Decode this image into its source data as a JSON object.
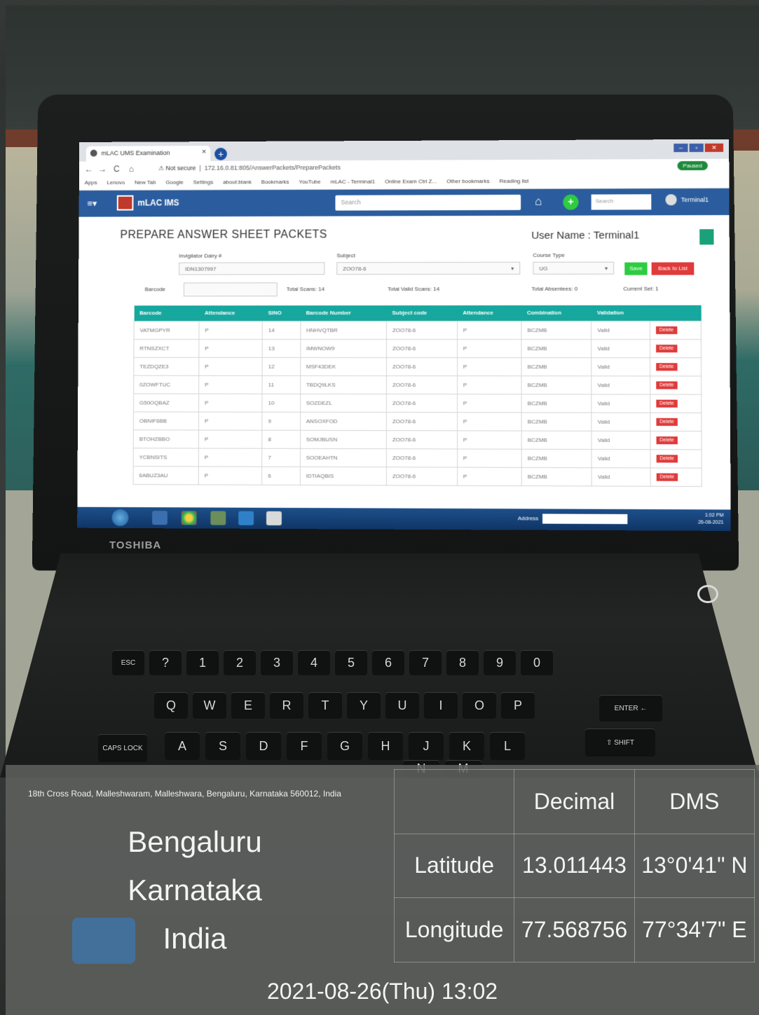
{
  "browser": {
    "tab_title": "mLAC UMS Examination",
    "tab_close": "×",
    "new_tab": "+",
    "back": "←",
    "forward": "→",
    "reload": "C",
    "home": "⌂",
    "not_secure": "⚠ Not secure",
    "url": "172.16.0.81:805/AnswerPackets/PreparePackets",
    "profile": "Paused",
    "win_min": "–",
    "win_max": "▫",
    "win_close": "✕",
    "bookmarks": [
      "Apps",
      "Lenovo",
      "New Tab",
      "Google",
      "Settings",
      "about:blank",
      "Bookmarks",
      "YouTube",
      "mLAC - Terminal1",
      "Online Exam Ctrl Z...",
      "Other bookmarks",
      "Reading list"
    ]
  },
  "app": {
    "menu": "≡▾",
    "logo_text": "mLAC IMS",
    "search_placeholder": "Search",
    "home_icon": "⌂",
    "add_icon": "+",
    "search2_placeholder": "Search",
    "user_chip": "Terminal1"
  },
  "page": {
    "title": "PREPARE ANSWER SHEET PACKETS",
    "user_name": "User Name : Terminal1",
    "invigilator_label": "Invigilator Dairy #",
    "invigilator_value": "IDN1307997",
    "subject_label": "Subject",
    "subject_value": "ZOO78-6",
    "course_type_label": "Course Type",
    "course_type_value": "UG",
    "save_label": "Save",
    "back_label": "Back to List",
    "barcode_label": "Barcode",
    "total_scans": "Total Scans: 14",
    "total_valid": "Total Valid Scans: 14",
    "total_absentees": "Total Absentees: 0",
    "current_set": "Current Set: 1"
  },
  "grid": {
    "headers": [
      "Barcode",
      "Attendance",
      "SlNO",
      "Barcode Number",
      "Subject code",
      "Attendance",
      "Combination",
      "Validation",
      ""
    ],
    "rows": [
      [
        "VATMGPYR",
        "P",
        "14",
        "HNHVQTBR",
        "ZOO78-6",
        "P",
        "BCZMB",
        "Valid",
        "Delete"
      ],
      [
        "RTNSZXCT",
        "P",
        "13",
        "IMWNOW9",
        "ZOO78-6",
        "P",
        "BCZMB",
        "Valid",
        "Delete"
      ],
      [
        "TEZDQZE3",
        "P",
        "12",
        "MSF43DEK",
        "ZOO78-6",
        "P",
        "BCZMB",
        "Valid",
        "Delete"
      ],
      [
        "0ZOWFTUC",
        "P",
        "11",
        "TBDQ9LKS",
        "ZOO78-6",
        "P",
        "BCZMB",
        "Valid",
        "Delete"
      ],
      [
        "G50OQBAZ",
        "P",
        "10",
        "SOZDEZL",
        "ZOO78-6",
        "P",
        "BCZMB",
        "Valid",
        "Delete"
      ],
      [
        "OBNIF6BB",
        "P",
        "9",
        "ANSOXFOD",
        "ZOO78-6",
        "P",
        "BCZMB",
        "Valid",
        "Delete"
      ],
      [
        "BTOHZBBO",
        "P",
        "8",
        "SOMJBUSN",
        "ZOO78-6",
        "P",
        "BCZMB",
        "Valid",
        "Delete"
      ],
      [
        "YCBNSITS",
        "P",
        "7",
        "SOOEAHTN",
        "ZOO78-6",
        "P",
        "BCZMB",
        "Valid",
        "Delete"
      ],
      [
        "6ABUZ3AU",
        "P",
        "6",
        "IDTIAQBIS",
        "ZOO78-6",
        "P",
        "BCZMB",
        "Valid",
        "Delete"
      ]
    ]
  },
  "taskbar": {
    "address_label": "Address",
    "time": "1:02 PM",
    "date": "26-08-2021"
  },
  "laptop": {
    "brand": "TOSHIBA",
    "keys_row1": [
      "ESC",
      "?",
      "1",
      "2",
      "3",
      "4",
      "5",
      "6",
      "7",
      "8",
      "9",
      "0"
    ],
    "keys_row2": [
      "Q",
      "W",
      "E",
      "R",
      "T",
      "Y",
      "U",
      "I",
      "O",
      "P"
    ],
    "keys_row3": [
      "A",
      "S",
      "D",
      "F",
      "G",
      "H",
      "J",
      "K",
      "L"
    ],
    "keys_row4": [
      "N",
      "M"
    ],
    "caps": "CAPS LOCK",
    "enter": "ENTER ←",
    "shift": "⇧ SHIFT"
  },
  "geo": {
    "address": "18th Cross Road, Malleshwaram, Malleshwara, Bengaluru, Karnataka 560012, India",
    "city": "Bengaluru",
    "state": "Karnataka",
    "country": "India",
    "col_decimal": "Decimal",
    "col_dms": "DMS",
    "lat_label": "Latitude",
    "lat_decimal": "13.011443",
    "lat_dms": "13°0'41\" N",
    "lon_label": "Longitude",
    "lon_decimal": "77.568756",
    "lon_dms": "77°34'7\" E",
    "datetime": "2021-08-26(Thu)   13:02"
  }
}
